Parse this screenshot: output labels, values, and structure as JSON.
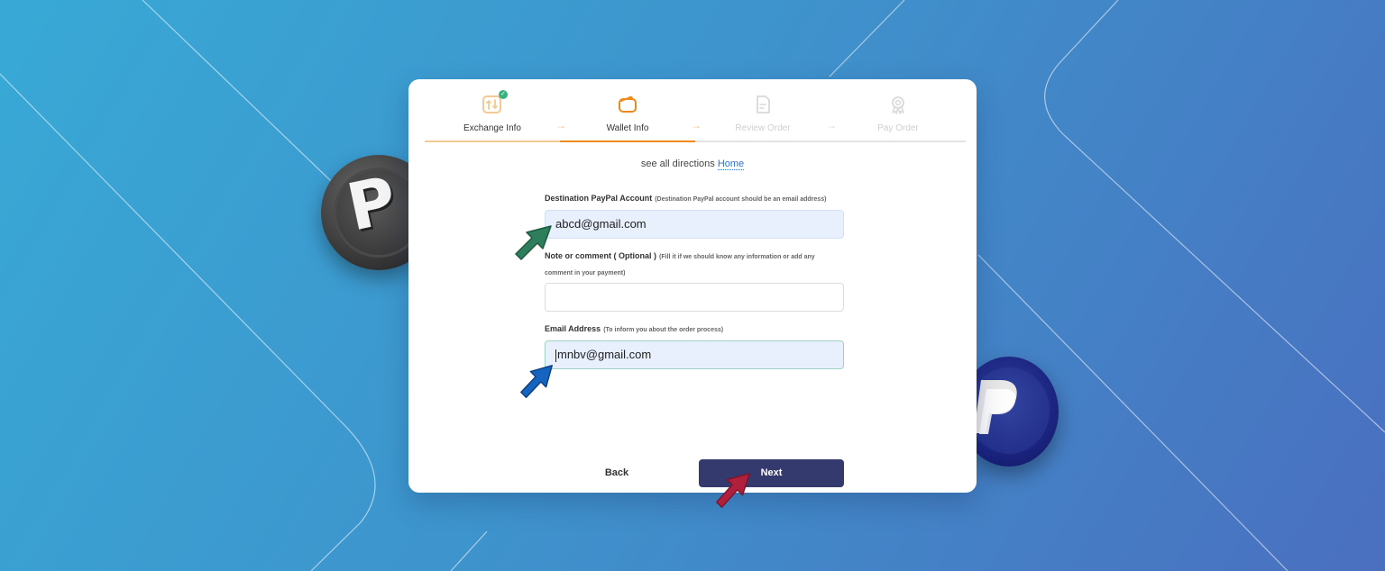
{
  "steps": [
    {
      "label": "Exchange Info",
      "icon": "exchange-icon",
      "state": "completed"
    },
    {
      "label": "Wallet Info",
      "icon": "wallet-icon",
      "state": "active"
    },
    {
      "label": "Review Order",
      "icon": "review-document-icon",
      "state": "upcoming"
    },
    {
      "label": "Pay Order",
      "icon": "award-badge-icon",
      "state": "upcoming"
    }
  ],
  "directions": {
    "text": "see all directions",
    "link": "Home"
  },
  "form": {
    "paypal_label": "Destination PayPal Account",
    "paypal_hint": "(Destination PayPal account should be an email address)",
    "paypal_value": "abcd@gmail.com",
    "note_label": "Note or comment ( Optional )",
    "note_hint": "(Fill it if we should know any information or add any comment in your payment)",
    "note_value": "",
    "email_label": "Email Address",
    "email_hint": "(To inform you about the order process)",
    "email_value": "mnbv@gmail.com"
  },
  "buttons": {
    "back": "Back",
    "next": "Next"
  },
  "colors": {
    "accent": "#f08a1c",
    "next_button": "#343a6e",
    "link": "#2f6fd6",
    "input_filled": "#e8f0fe",
    "cursor_green": "#2e7d5b",
    "cursor_blue": "#1565c0",
    "cursor_red": "#b0203c"
  }
}
